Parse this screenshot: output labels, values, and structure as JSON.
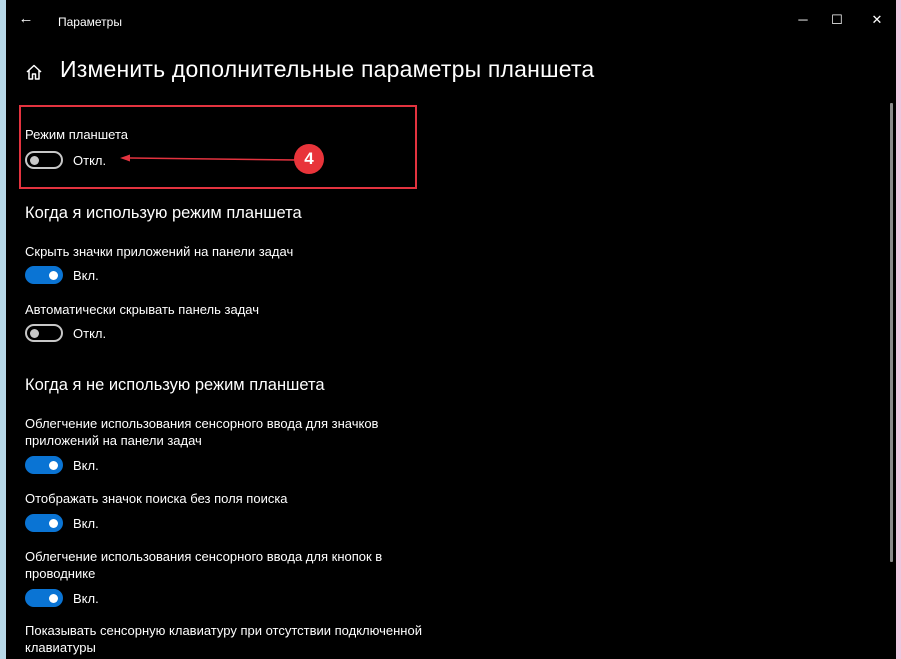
{
  "window": {
    "title": "Параметры",
    "controls": {
      "minimize": "─",
      "maximize": "☐",
      "close": "✕"
    }
  },
  "page": {
    "title": "Изменить дополнительные параметры планшета"
  },
  "tablet_mode": {
    "label": "Режим планшета",
    "state": "Откл.",
    "on": false
  },
  "annotation": {
    "marker": "4",
    "color": "#e3333f"
  },
  "section_when_using": {
    "title": "Когда я использую режим планшета",
    "settings": [
      {
        "label": "Скрыть значки приложений на панели задач",
        "state": "Вкл.",
        "on": true
      },
      {
        "label": "Автоматически скрывать панель задач",
        "state": "Откл.",
        "on": false
      }
    ]
  },
  "section_when_not_using": {
    "title": "Когда я не использую режим планшета",
    "settings": [
      {
        "label_line1": "Облегчение использования сенсорного ввода для значков",
        "label_line2": "приложений на панели задач",
        "state": "Вкл.",
        "on": true
      },
      {
        "label_line1": "Отображать значок поиска без поля поиска",
        "state": "Вкл.",
        "on": true
      },
      {
        "label_line1": "Облегчение использования сенсорного ввода для кнопок в",
        "label_line2": "проводнике",
        "state": "Вкл.",
        "on": true
      },
      {
        "label_line1": "Показывать сенсорную клавиатуру при отсутствии подключенной",
        "label_line2": "клавиатуры"
      }
    ]
  },
  "colors": {
    "accent": "#0a74d4",
    "background": "#000000",
    "annotation": "#e3333f"
  },
  "icons": {
    "back": "back-arrow-icon",
    "home": "home-icon"
  }
}
